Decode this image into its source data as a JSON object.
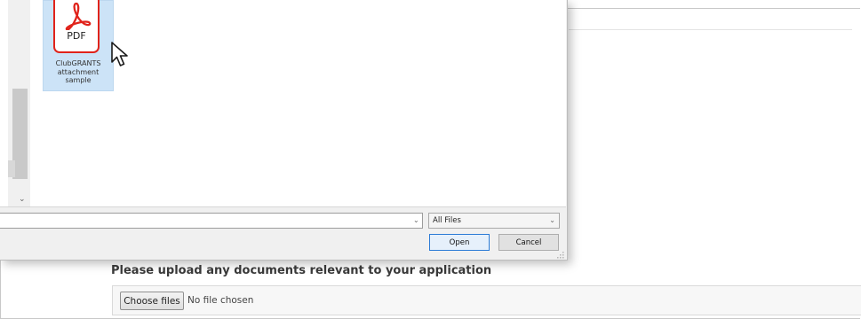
{
  "dialog": {
    "file": {
      "icon": "pdf-file-icon",
      "icon_label": "PDF",
      "caption_lines": [
        "ClubGRANTS",
        "attachment",
        "sample"
      ]
    },
    "filename": "",
    "file_type_filter": "All Files",
    "open_label": "Open",
    "cancel_label": "Cancel"
  },
  "page": {
    "upload_heading": "Please upload any documents relevant to your application",
    "choose_files_label": "Choose files",
    "no_file_text": "No file chosen"
  },
  "colors": {
    "pdf_red": "#e0231b",
    "selection": "#cce3f7",
    "accent": "#2b7bd6"
  }
}
